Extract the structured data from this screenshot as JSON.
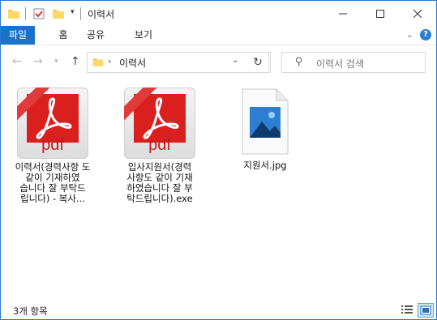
{
  "window": {
    "title": "이력서"
  },
  "ribbon": {
    "tabs": [
      {
        "label": "파일"
      },
      {
        "label": "홈"
      },
      {
        "label": "공유"
      },
      {
        "label": "보기"
      }
    ],
    "help_label": "?"
  },
  "nav": {
    "breadcrumb_arrow": "›",
    "address": "이력서",
    "search_placeholder": "이력서 검색"
  },
  "files": [
    {
      "name": "이력서(경력사항 도 같이 기재하였 습니다 잘 부탁드 립니다) - 복사...",
      "type": "pdf",
      "icon": "pdf-icon",
      "icon_text": "pdf"
    },
    {
      "name": "입사지원서(경력 사항도 같이 기재 하였습니다 잘 부 탁드립니다).exe",
      "type": "pdf",
      "icon": "pdf-icon",
      "icon_text": "pdf"
    },
    {
      "name": "지원서.jpg",
      "type": "image",
      "icon": "image-file-icon"
    }
  ],
  "status": {
    "item_count": "3개 항목"
  },
  "colors": {
    "accent": "#1a73c7",
    "pdf_red": "#d9201f"
  }
}
